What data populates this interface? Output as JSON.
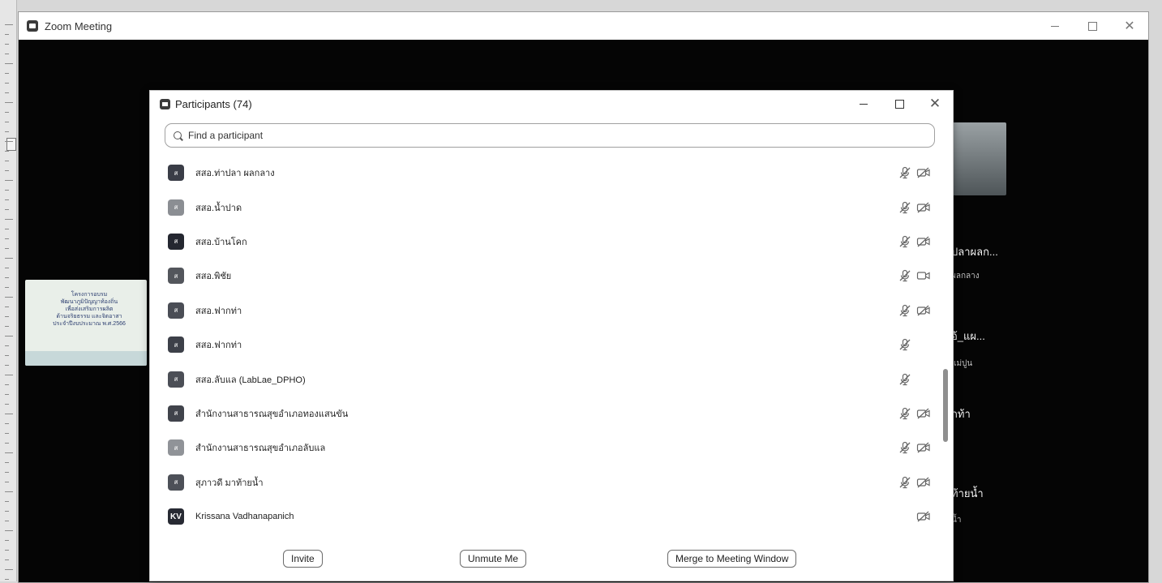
{
  "zoom_window": {
    "title": "Zoom Meeting",
    "controls": {
      "minimize": "–",
      "maximize": "☐",
      "close": "✕"
    }
  },
  "background": {
    "banner_lines": [
      "โครงการอบรม",
      "พัฒนาภูมิปัญญาท้องถิ่น",
      "เพื่อส่งเสริมการผลิต",
      "ด้านจริยธรรม และจิตอาสา",
      "ประจำปีงบประมาณ พ.ศ.2566"
    ],
    "names": [
      {
        "name": "ปลาผลก...",
        "sub": "ผลกลาง"
      },
      {
        "name": "อ้_แผ...",
        "sub": "แม่ปูน"
      },
      {
        "name": "กท้า",
        "sub": ""
      },
      {
        "name": "ท้ายน้ำ",
        "sub": "น้ำ"
      }
    ]
  },
  "participants_panel": {
    "title": "Participants (74)",
    "controls": {
      "minimize": "–",
      "maximize": "☐",
      "close": "✕"
    },
    "search_placeholder": "Find a participant",
    "participants": [
      {
        "avatar": "ส",
        "avatar_color": "#3a3d47",
        "name": "สสอ.ท่าปลา ผลกลาง",
        "mic_muted": true,
        "video_off": true
      },
      {
        "avatar": "ส",
        "avatar_color": "#8b8e93",
        "name": "สสอ.น้ำปาด",
        "mic_muted": true,
        "video_off": true
      },
      {
        "avatar": "ส",
        "avatar_color": "#242730",
        "name": "สสอ.บ้านโคก",
        "mic_muted": true,
        "video_off": true
      },
      {
        "avatar": "ส",
        "avatar_color": "#53565c",
        "name": "สสอ.พิชัย",
        "mic_muted": true,
        "video_off": false
      },
      {
        "avatar": "ส",
        "avatar_color": "#4a4d55",
        "name": "สสอ.ฟากท่า",
        "mic_muted": true,
        "video_off": true
      },
      {
        "avatar": "ส",
        "avatar_color": "#3d4049",
        "name": "สสอ.ฟากท่า",
        "mic_muted": true,
        "video_off": null
      },
      {
        "avatar": "ส",
        "avatar_color": "#4b4e56",
        "name": "สสอ.ลับแล (LabLae_DPHO)",
        "mic_muted": true,
        "video_off": null
      },
      {
        "avatar": "ส",
        "avatar_color": "#40434b",
        "name": "สำนักงานสาธารณสุขอำเภอทองแสนขัน",
        "mic_muted": true,
        "video_off": true
      },
      {
        "avatar": "ส",
        "avatar_color": "#909398",
        "name": "สำนักงานสาธารณสุขอำเภอลับแล",
        "mic_muted": true,
        "video_off": true
      },
      {
        "avatar": "ส",
        "avatar_color": "#4d5058",
        "name": "สุภาวดี มาท้ายน้ำ",
        "mic_muted": true,
        "video_off": true
      },
      {
        "avatar": "KV",
        "avatar_color": "#272a33",
        "name": "Krissana Vadhanapanich",
        "mic_muted": null,
        "video_off": true
      }
    ],
    "scroll_position": 0.71,
    "footer": {
      "invite_label": "Invite",
      "unmute_label": "Unmute Me",
      "merge_label": "Merge to Meeting Window"
    }
  },
  "icons": {
    "app": "zoom-logo-icon",
    "search": "search-icon",
    "mic": "mic-muted-icon",
    "video_off": "video-off-icon",
    "video_on": "video-on-icon"
  }
}
